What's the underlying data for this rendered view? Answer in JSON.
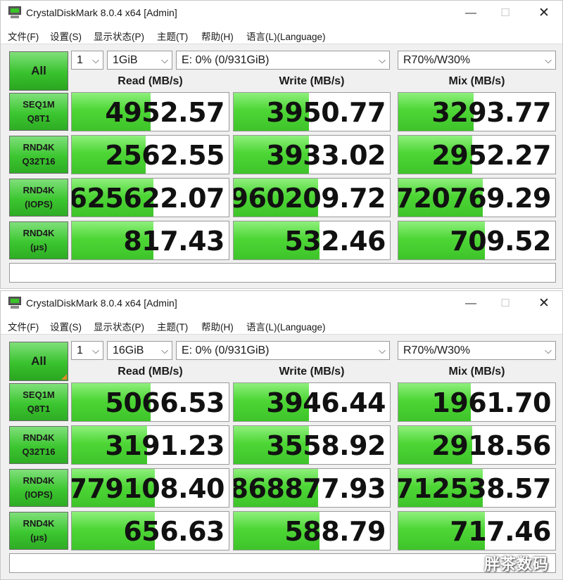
{
  "windows": [
    {
      "title": "CrystalDiskMark 8.0.4 x64 [Admin]",
      "controls": {
        "minimize": "—",
        "maximize": "☐",
        "close": "✕"
      },
      "menu": [
        "文件(F)",
        "设置(S)",
        "显示状态(P)",
        "主题(T)",
        "帮助(H)",
        "语言(L)(Language)"
      ],
      "all_button": "All",
      "test_count": "1",
      "test_size": "1GiB",
      "drive": "E: 0% (0/931GiB)",
      "mix_mode": "R70%/W30%",
      "headers": {
        "read": "Read (MB/s)",
        "write": "Write (MB/s)",
        "mix": "Mix (MB/s)"
      },
      "rows": [
        {
          "label1": "SEQ1M",
          "label2": "Q8T1",
          "read": "4952.57",
          "write": "3950.77",
          "mix": "3293.77",
          "fill_read": 0.5,
          "fill_write": 0.48,
          "fill_mix": 0.48
        },
        {
          "label1": "RND4K",
          "label2": "Q32T16",
          "read": "2562.55",
          "write": "3933.02",
          "mix": "2952.27",
          "fill_read": 0.47,
          "fill_write": 0.48,
          "fill_mix": 0.47
        },
        {
          "label1": "RND4K",
          "label2": "(IOPS)",
          "read": "625622.07",
          "write": "960209.72",
          "mix": "720769.29",
          "fill_read": 0.52,
          "fill_write": 0.54,
          "fill_mix": 0.54
        },
        {
          "label1": "RND4K",
          "label2": "(μs)",
          "read": "817.43",
          "write": "532.46",
          "mix": "709.52",
          "fill_read": 0.52,
          "fill_write": 0.55,
          "fill_mix": 0.55
        }
      ],
      "comment": ""
    },
    {
      "title": "CrystalDiskMark 8.0.4 x64 [Admin]",
      "controls": {
        "minimize": "—",
        "maximize": "☐",
        "close": "✕"
      },
      "menu": [
        "文件(F)",
        "设置(S)",
        "显示状态(P)",
        "主题(T)",
        "帮助(H)",
        "语言(L)(Language)"
      ],
      "all_button": "All",
      "test_count": "1",
      "test_size": "16GiB",
      "drive": "E: 0% (0/931GiB)",
      "mix_mode": "R70%/W30%",
      "headers": {
        "read": "Read (MB/s)",
        "write": "Write (MB/s)",
        "mix": "Mix (MB/s)"
      },
      "rows": [
        {
          "label1": "SEQ1M",
          "label2": "Q8T1",
          "read": "5066.53",
          "write": "3946.44",
          "mix": "1961.70",
          "fill_read": 0.5,
          "fill_write": 0.48,
          "fill_mix": 0.46
        },
        {
          "label1": "RND4K",
          "label2": "Q32T16",
          "read": "3191.23",
          "write": "3558.92",
          "mix": "2918.56",
          "fill_read": 0.48,
          "fill_write": 0.48,
          "fill_mix": 0.47
        },
        {
          "label1": "RND4K",
          "label2": "(IOPS)",
          "read": "779108.40",
          "write": "868877.93",
          "mix": "712538.57",
          "fill_read": 0.53,
          "fill_write": 0.54,
          "fill_mix": 0.54
        },
        {
          "label1": "RND4K",
          "label2": "(μs)",
          "read": "656.63",
          "write": "588.79",
          "mix": "717.46",
          "fill_read": 0.53,
          "fill_write": 0.55,
          "fill_mix": 0.55
        }
      ],
      "comment": ""
    }
  ],
  "watermark": "胖茶数码"
}
